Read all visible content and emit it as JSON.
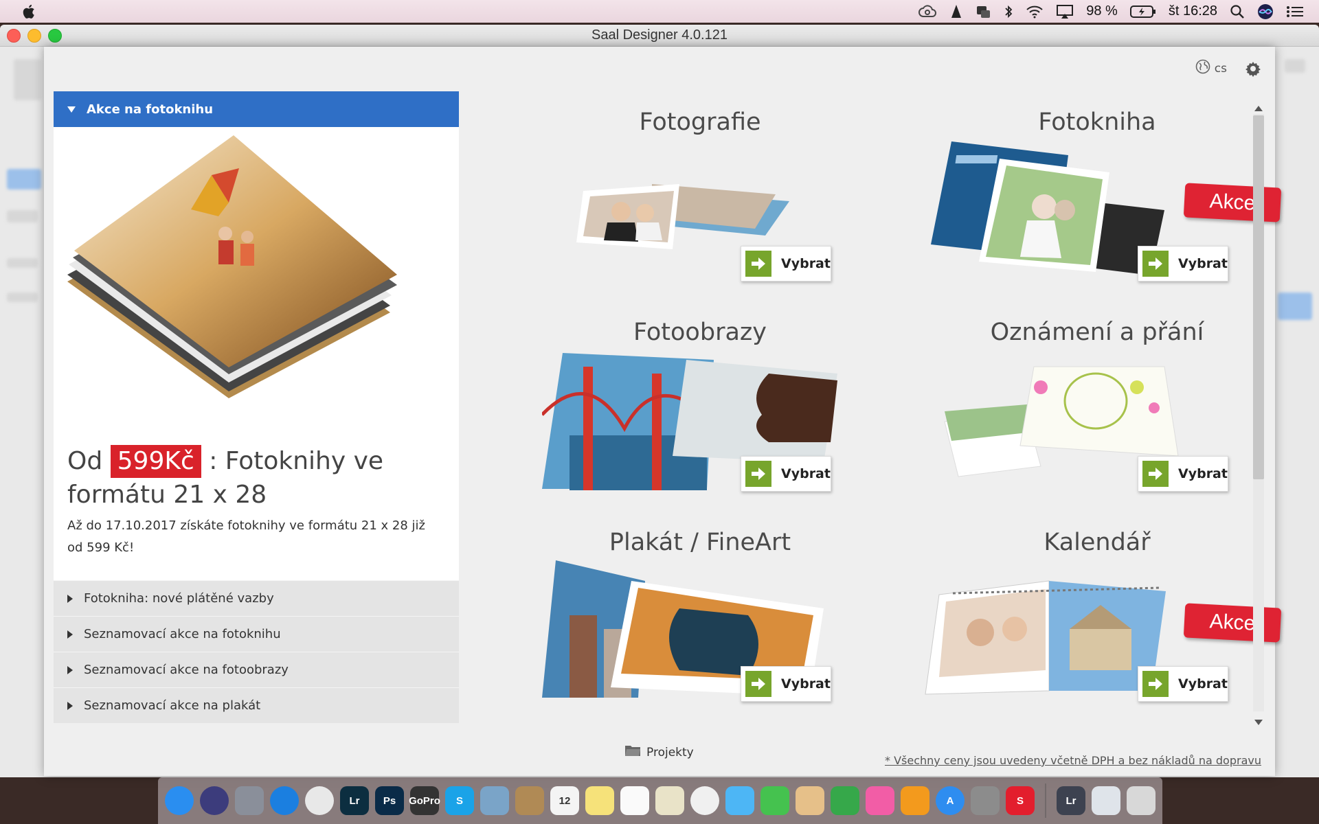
{
  "menubar": {
    "battery_text": "98 %",
    "clock": "št 16:28",
    "icons": [
      "apple-icon",
      "creative-cloud-icon",
      "app-icon",
      "dropbox-icon",
      "bluetooth-icon",
      "wifi-icon",
      "airplay-icon",
      "battery-icon",
      "search-icon",
      "siri-icon",
      "list-icon"
    ]
  },
  "window": {
    "title": "Saal Designer 4.0.121"
  },
  "dialog": {
    "language": "cs",
    "promo": {
      "header": "Akce na fotoknihu",
      "title_prefix": "Od",
      "price": "599Kč",
      "title_rest": ": Fotoknihy ve formátu 21 x 28",
      "description": "Až do 17.10.2017 získáte fotoknihy ve formátu 21 x 28 již od 599 Kč!",
      "items": [
        {
          "label": "Fotokniha: nové plátěné vazby"
        },
        {
          "label": "Seznamovací akce na fotoknihu"
        },
        {
          "label": "Seznamovací akce na fotoobrazy"
        },
        {
          "label": "Seznamovací akce na plakát"
        }
      ]
    },
    "products": [
      {
        "title": "Fotografie",
        "button": "Vybrat",
        "akce": ""
      },
      {
        "title": "Fotokniha",
        "button": "Vybrat",
        "akce": "Akce"
      },
      {
        "title": "Fotoobrazy",
        "button": "Vybrat",
        "akce": ""
      },
      {
        "title": "Oznámení a přání",
        "button": "Vybrat",
        "akce": ""
      },
      {
        "title": "Plakát / FineArt",
        "button": "Vybrat",
        "akce": ""
      },
      {
        "title": "Kalendář",
        "button": "Vybrat",
        "akce": "Akce"
      }
    ],
    "footer": {
      "projects": "Projekty",
      "note": "* Všechny ceny jsou uvedeny včetně DPH a bez nákladů na dopravu"
    }
  },
  "dock": {
    "apps": [
      {
        "name": "finder",
        "color": "#2a8ef0",
        "label": ""
      },
      {
        "name": "siri",
        "color": "#3c3c7c",
        "label": ""
      },
      {
        "name": "launchpad",
        "color": "#8a8f9a",
        "label": ""
      },
      {
        "name": "safari",
        "color": "#1b7fe0",
        "label": ""
      },
      {
        "name": "chrome",
        "color": "#e8e8e8",
        "label": ""
      },
      {
        "name": "lightroom",
        "color": "#0c2e40",
        "label": "Lr"
      },
      {
        "name": "photoshop",
        "color": "#0a2b48",
        "label": "Ps"
      },
      {
        "name": "gopro",
        "color": "#333333",
        "label": "GoPro"
      },
      {
        "name": "skype",
        "color": "#1aa3e8",
        "label": "S"
      },
      {
        "name": "preview",
        "color": "#7aa4c8",
        "label": ""
      },
      {
        "name": "contacts",
        "color": "#b08a55",
        "label": ""
      },
      {
        "name": "calendar",
        "color": "#f4f4f4",
        "label": "12"
      },
      {
        "name": "notes",
        "color": "#f6e27a",
        "label": ""
      },
      {
        "name": "reminders",
        "color": "#fafafa",
        "label": ""
      },
      {
        "name": "photo-booth",
        "color": "#e9e3c8",
        "label": ""
      },
      {
        "name": "photos",
        "color": "#f0f0f0",
        "label": ""
      },
      {
        "name": "messages",
        "color": "#4db6f5",
        "label": ""
      },
      {
        "name": "facetime",
        "color": "#45c24f",
        "label": ""
      },
      {
        "name": "sketchbook",
        "color": "#e6c089",
        "label": ""
      },
      {
        "name": "numbers",
        "color": "#36a84a",
        "label": ""
      },
      {
        "name": "itunes",
        "color": "#f25da6",
        "label": ""
      },
      {
        "name": "ibooks",
        "color": "#f39a1d",
        "label": ""
      },
      {
        "name": "app-store",
        "color": "#2e8df0",
        "label": "A"
      },
      {
        "name": "system-preferences",
        "color": "#8c8c8c",
        "label": ""
      },
      {
        "name": "saal-designer",
        "color": "#e31e2d",
        "label": "S"
      },
      {
        "name": "lightroom-preset",
        "color": "#3d4250",
        "label": "Lr"
      },
      {
        "name": "document-stack",
        "color": "#dfe4ea",
        "label": ""
      },
      {
        "name": "trash",
        "color": "#d8d8d8",
        "label": ""
      }
    ]
  }
}
